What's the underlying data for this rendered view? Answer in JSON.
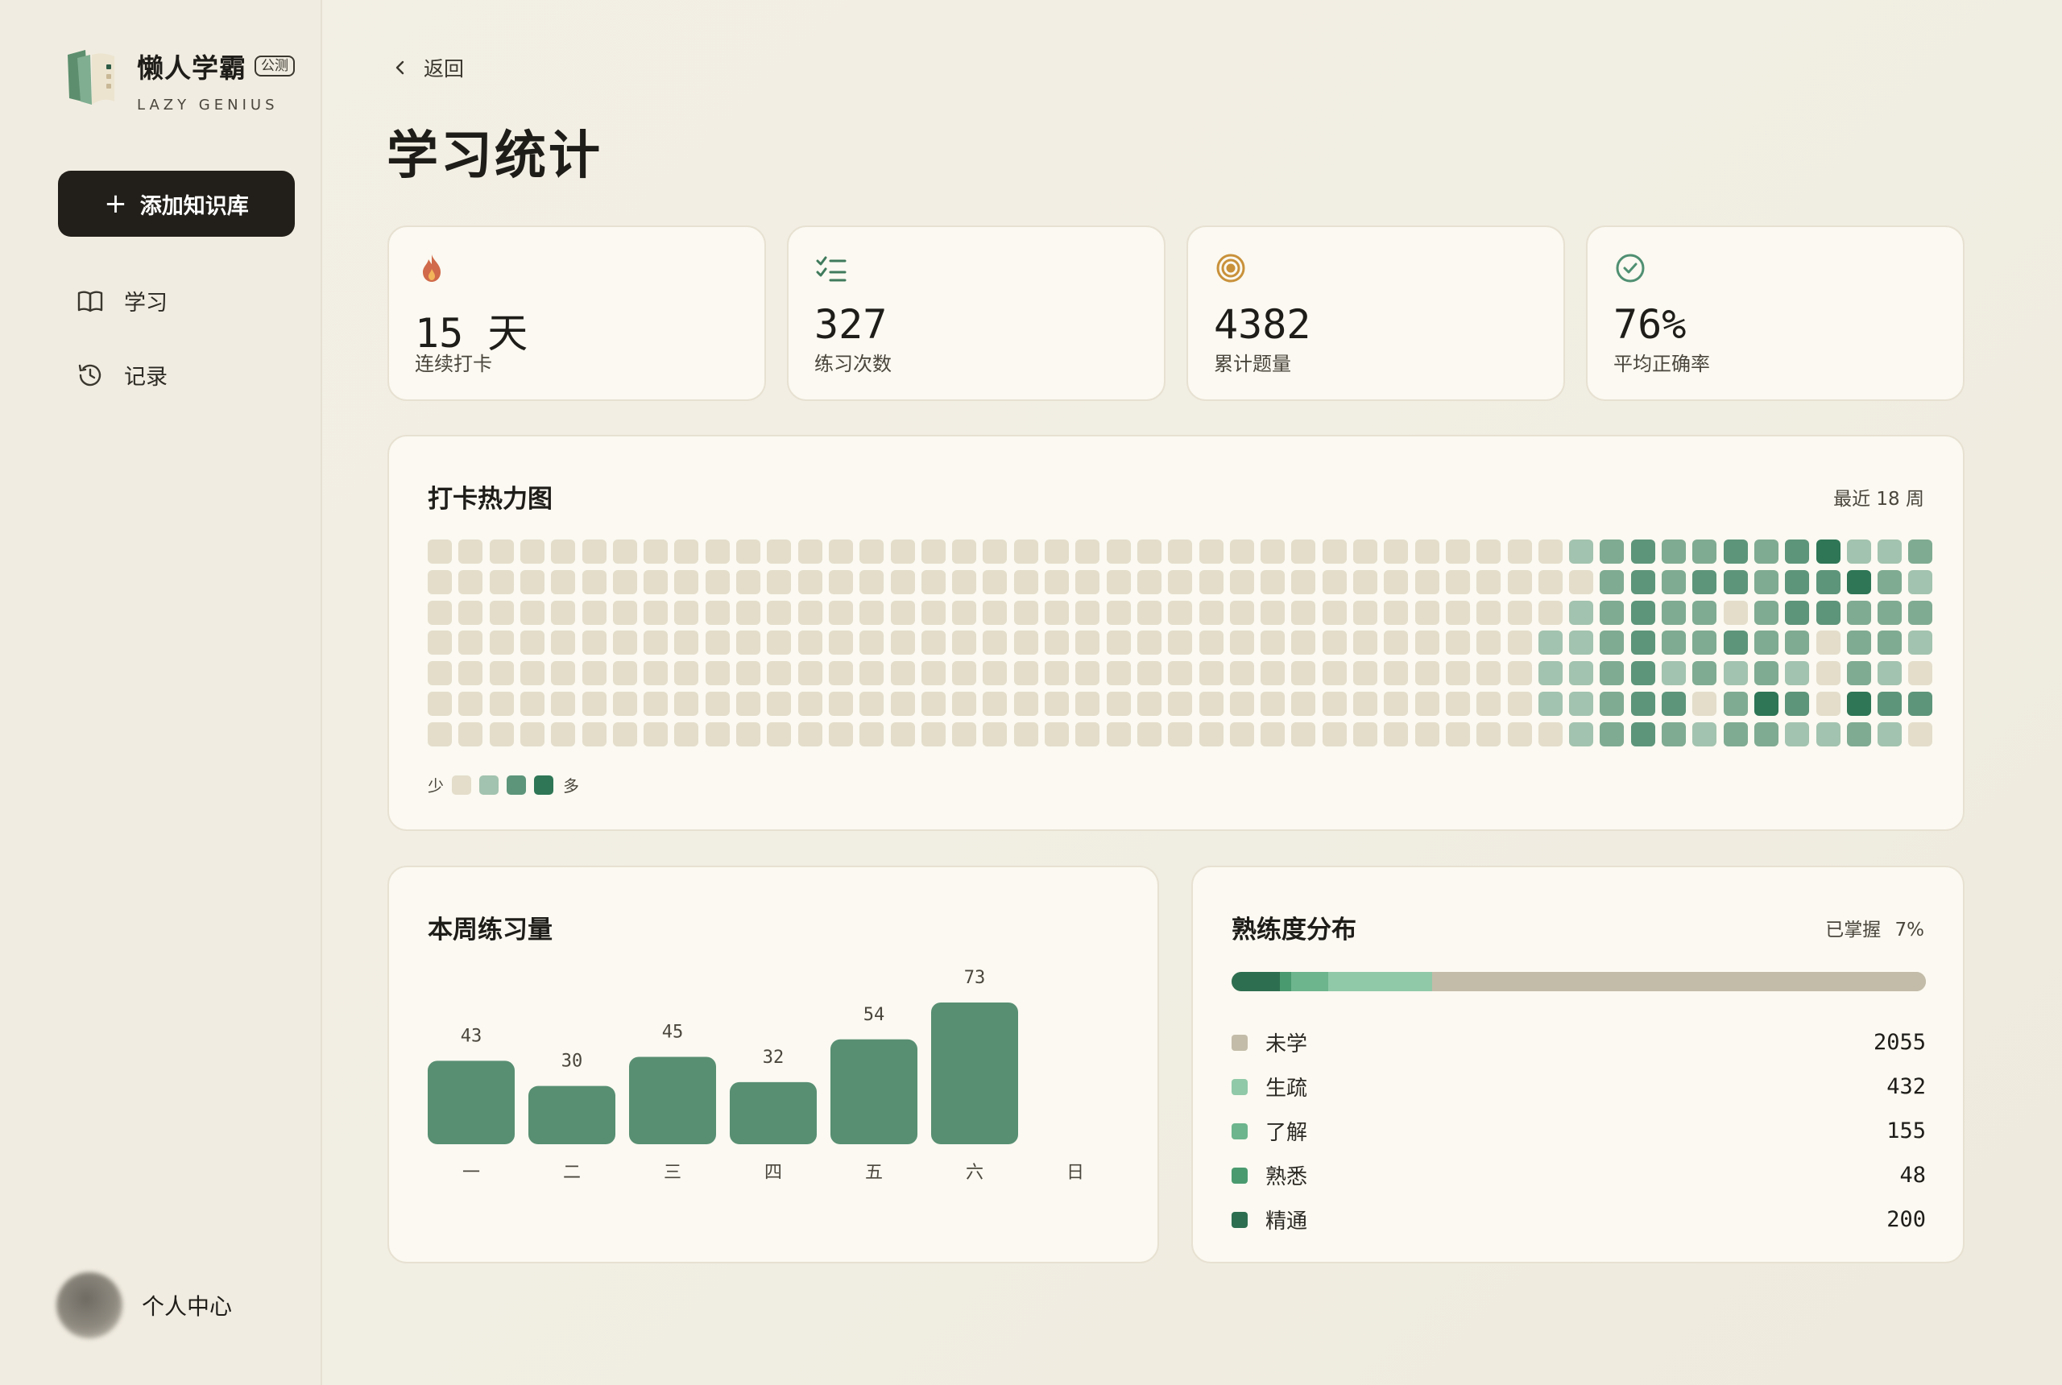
{
  "sidebar": {
    "app_name": "懒人学霸",
    "badge": "公测",
    "subtitle": "LAZY GENIUS",
    "add_button": "添加知识库",
    "nav": [
      {
        "label": "学习",
        "icon": "book-icon"
      },
      {
        "label": "记录",
        "icon": "history-icon"
      }
    ],
    "profile_label": "个人中心"
  },
  "header": {
    "back_label": "返回",
    "title": "学习统计"
  },
  "stats": [
    {
      "value": "15 天",
      "label": "连续打卡",
      "icon": "flame-icon"
    },
    {
      "value": "327",
      "label": "练习次数",
      "icon": "checklist-icon"
    },
    {
      "value": "4382",
      "label": "累计题量",
      "icon": "target-icon"
    },
    {
      "value": "76%",
      "label": "平均正确率",
      "icon": "check-circle-icon"
    }
  ],
  "heatmap": {
    "title": "打卡热力图",
    "range_label": "最近 18 周",
    "legend_less": "少",
    "legend_more": "多",
    "colors": [
      "#e3ddca",
      "#a2c3af",
      "#7fab92",
      "#5d957a",
      "#2e7656"
    ],
    "columns": 49,
    "rows": 7,
    "levels": [
      [
        0,
        0,
        0,
        0,
        0,
        0,
        0,
        0,
        0,
        0,
        0,
        0,
        0,
        0,
        0,
        0,
        0,
        0,
        0,
        0,
        0,
        0,
        0,
        0,
        0,
        0,
        0,
        0,
        0,
        0,
        0,
        0,
        0,
        0,
        0,
        0,
        0,
        0,
        0,
        0,
        1,
        2,
        3,
        2,
        2,
        3,
        2,
        3,
        4,
        1,
        1,
        2
      ],
      [
        0,
        0,
        0,
        0,
        0,
        0,
        0,
        0,
        0,
        0,
        0,
        0,
        0,
        0,
        0,
        0,
        0,
        0,
        0,
        0,
        0,
        0,
        0,
        0,
        0,
        0,
        0,
        0,
        0,
        0,
        0,
        0,
        0,
        0,
        0,
        0,
        0,
        0,
        0,
        0,
        0,
        2,
        3,
        2,
        3,
        3,
        2,
        3,
        3,
        4,
        2,
        1
      ],
      [
        0,
        0,
        0,
        0,
        0,
        0,
        0,
        0,
        0,
        0,
        0,
        0,
        0,
        0,
        0,
        0,
        0,
        0,
        0,
        0,
        0,
        0,
        0,
        0,
        0,
        0,
        0,
        0,
        0,
        0,
        0,
        0,
        0,
        0,
        0,
        0,
        0,
        0,
        0,
        0,
        1,
        2,
        3,
        2,
        2,
        0,
        2,
        3,
        3,
        2,
        2,
        2
      ],
      [
        0,
        0,
        0,
        0,
        0,
        0,
        0,
        0,
        0,
        0,
        0,
        0,
        0,
        0,
        0,
        0,
        0,
        0,
        0,
        0,
        0,
        0,
        0,
        0,
        0,
        0,
        0,
        0,
        0,
        0,
        0,
        0,
        0,
        0,
        0,
        0,
        0,
        0,
        0,
        1,
        1,
        2,
        3,
        2,
        2,
        3,
        2,
        2,
        0,
        2,
        2,
        1
      ],
      [
        0,
        0,
        0,
        0,
        0,
        0,
        0,
        0,
        0,
        0,
        0,
        0,
        0,
        0,
        0,
        0,
        0,
        0,
        0,
        0,
        0,
        0,
        0,
        0,
        0,
        0,
        0,
        0,
        0,
        0,
        0,
        0,
        0,
        0,
        0,
        0,
        0,
        0,
        0,
        1,
        1,
        2,
        3,
        1,
        2,
        1,
        2,
        1,
        0,
        2,
        1,
        0
      ],
      [
        0,
        0,
        0,
        0,
        0,
        0,
        0,
        0,
        0,
        0,
        0,
        0,
        0,
        0,
        0,
        0,
        0,
        0,
        0,
        0,
        0,
        0,
        0,
        0,
        0,
        0,
        0,
        0,
        0,
        0,
        0,
        0,
        0,
        0,
        0,
        0,
        0,
        0,
        0,
        1,
        1,
        2,
        3,
        3,
        0,
        2,
        4,
        3,
        0,
        4,
        3,
        3
      ],
      [
        0,
        0,
        0,
        0,
        0,
        0,
        0,
        0,
        0,
        0,
        0,
        0,
        0,
        0,
        0,
        0,
        0,
        0,
        0,
        0,
        0,
        0,
        0,
        0,
        0,
        0,
        0,
        0,
        0,
        0,
        0,
        0,
        0,
        0,
        0,
        0,
        0,
        0,
        0,
        0,
        1,
        2,
        3,
        2,
        1,
        2,
        2,
        1,
        1,
        2,
        1,
        0
      ]
    ]
  },
  "weekly": {
    "title": "本周练习量",
    "bar_color": "#588f73",
    "chart_data": {
      "type": "bar",
      "categories": [
        "一",
        "二",
        "三",
        "四",
        "五",
        "六",
        "日"
      ],
      "values": [
        43,
        30,
        45,
        32,
        54,
        73,
        null
      ],
      "ylim": [
        0,
        73
      ]
    }
  },
  "mastery": {
    "title": "熟练度分布",
    "mastered_label": "已掌握",
    "mastered_value": "7%",
    "chart_data": {
      "type": "bar",
      "categories": [
        "未学",
        "生疏",
        "了解",
        "熟悉",
        "精通"
      ],
      "values": [
        2055,
        432,
        155,
        48,
        200
      ]
    },
    "items": [
      {
        "label": "未学",
        "value": "2055",
        "color": "#c3bca9"
      },
      {
        "label": "生疏",
        "value": "432",
        "color": "#90c9a8"
      },
      {
        "label": "了解",
        "value": "155",
        "color": "#6db58d"
      },
      {
        "label": "熟悉",
        "value": "48",
        "color": "#4a9a6f"
      },
      {
        "label": "精通",
        "value": "200",
        "color": "#2d6e50"
      }
    ]
  }
}
